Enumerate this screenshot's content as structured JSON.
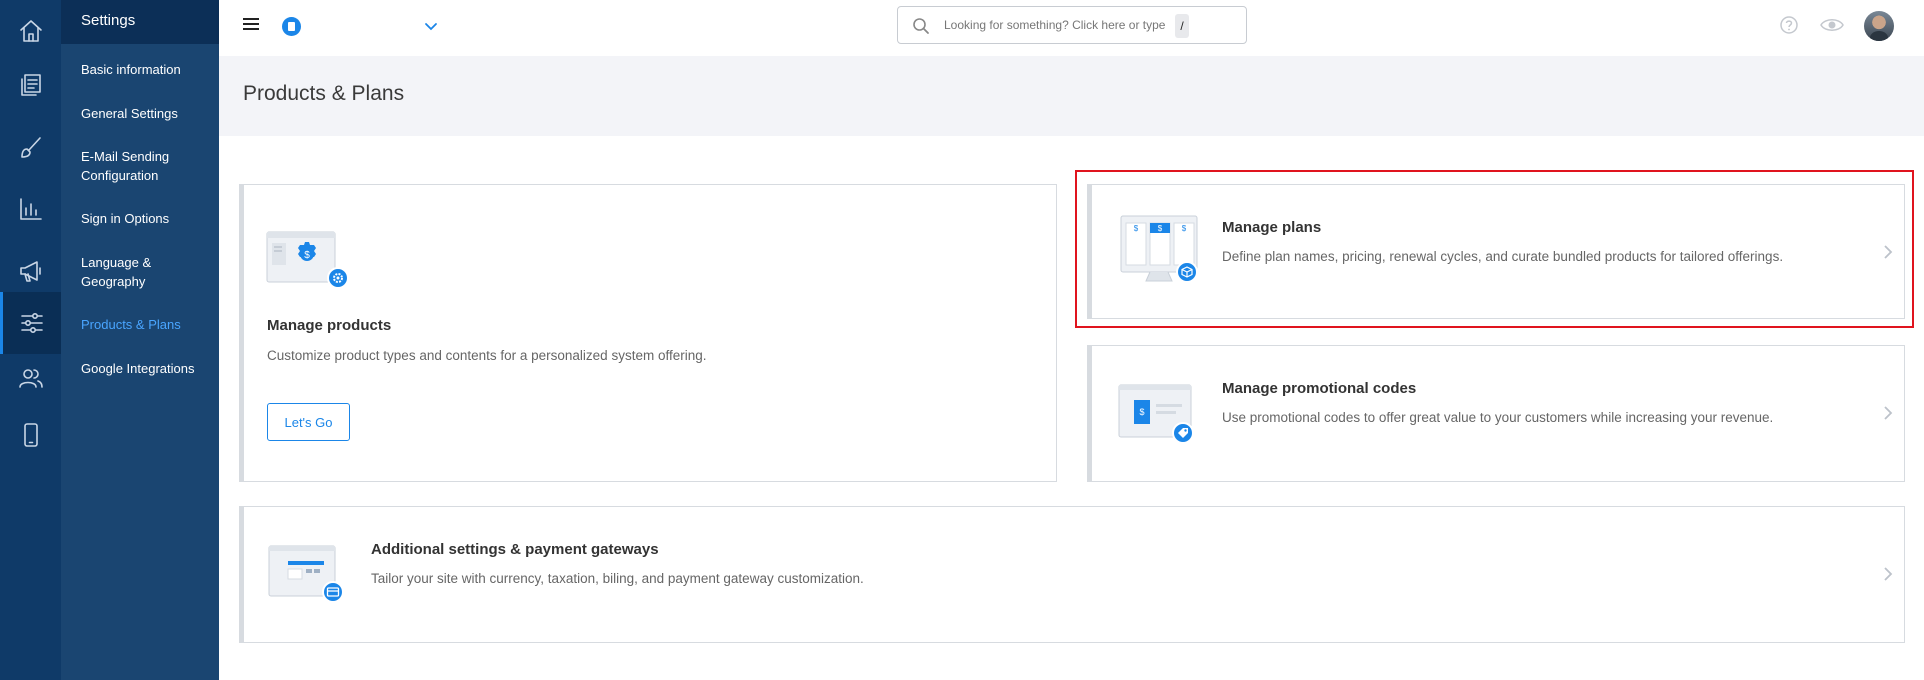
{
  "rail": {
    "items": [
      {
        "icon": "home-icon"
      },
      {
        "icon": "pages-icon"
      },
      {
        "icon": "brush-icon"
      },
      {
        "icon": "chart-icon"
      },
      {
        "icon": "megaphone-icon"
      },
      {
        "icon": "sliders-icon",
        "active": true
      },
      {
        "icon": "users-icon"
      },
      {
        "icon": "mobile-icon"
      }
    ]
  },
  "submenu": {
    "title": "Settings",
    "items": [
      {
        "label": "Basic information"
      },
      {
        "label": "General Settings"
      },
      {
        "label": "E-Mail Sending Configuration"
      },
      {
        "label": "Sign in Options"
      },
      {
        "label": "Language & Geography"
      },
      {
        "label": "Products & Plans",
        "active": true
      },
      {
        "label": "Google Integrations"
      }
    ]
  },
  "topbar": {
    "search_placeholder": "Looking for something? Click here or type",
    "search_shortcut": "/"
  },
  "page": {
    "title": "Products & Plans"
  },
  "cards": {
    "manage_products": {
      "title": "Manage products",
      "description": "Customize product types and contents for a personalized system offering.",
      "button": "Let's Go"
    },
    "manage_plans": {
      "title": "Manage plans",
      "description": "Define plan names, pricing, renewal cycles, and curate bundled products for tailored offerings."
    },
    "manage_promo": {
      "title": "Manage promotional codes",
      "description": "Use promotional codes to offer great value to your customers while increasing your revenue."
    },
    "additional": {
      "title": "Additional settings & payment gateways",
      "description": "Tailor your site with currency, taxation, biling, and payment gateway customization."
    }
  },
  "colors": {
    "rail_bg": "#0f3a68",
    "submenu_bg": "#1a4571",
    "accent": "#1b86e8",
    "highlight": "#e0141e"
  }
}
